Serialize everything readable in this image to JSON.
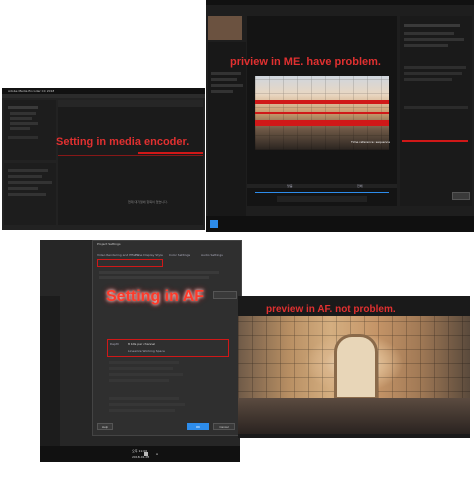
{
  "annotations": {
    "setting_media_encoder": "Setting in media encoder.",
    "preview_me": "priview in ME. have problem.",
    "setting_af": "Setting in AF",
    "preview_af": "preview in AF. not problem."
  },
  "media_encoder_settings": {
    "title": "Adobe Media Encoder CC 2018",
    "status_text": "현재 대기열에 항목이 없습니다."
  },
  "me_preview": {
    "vr_label": "Time reference: sequence",
    "zoom": "맞춤",
    "quality": "전체"
  },
  "after_effects": {
    "dialog_title": "Project Settings",
    "tabs": [
      "Video Rendering and Effects",
      "Time Display Style",
      "Color Settings",
      "Audio Settings"
    ],
    "depth_label": "Depth",
    "depth_value": "8 bits per channel",
    "linearize_label": "Linearize Working Space",
    "ok_label": "OK",
    "cancel_label": "Cancel",
    "help_label": "Help",
    "clock_time": "오후 11:06",
    "clock_date": "2018-01-05",
    "lang": "A"
  },
  "colors": {
    "callout_red": "#e03030",
    "app_dark": "#232323",
    "accent_blue": "#2d8ceb"
  }
}
